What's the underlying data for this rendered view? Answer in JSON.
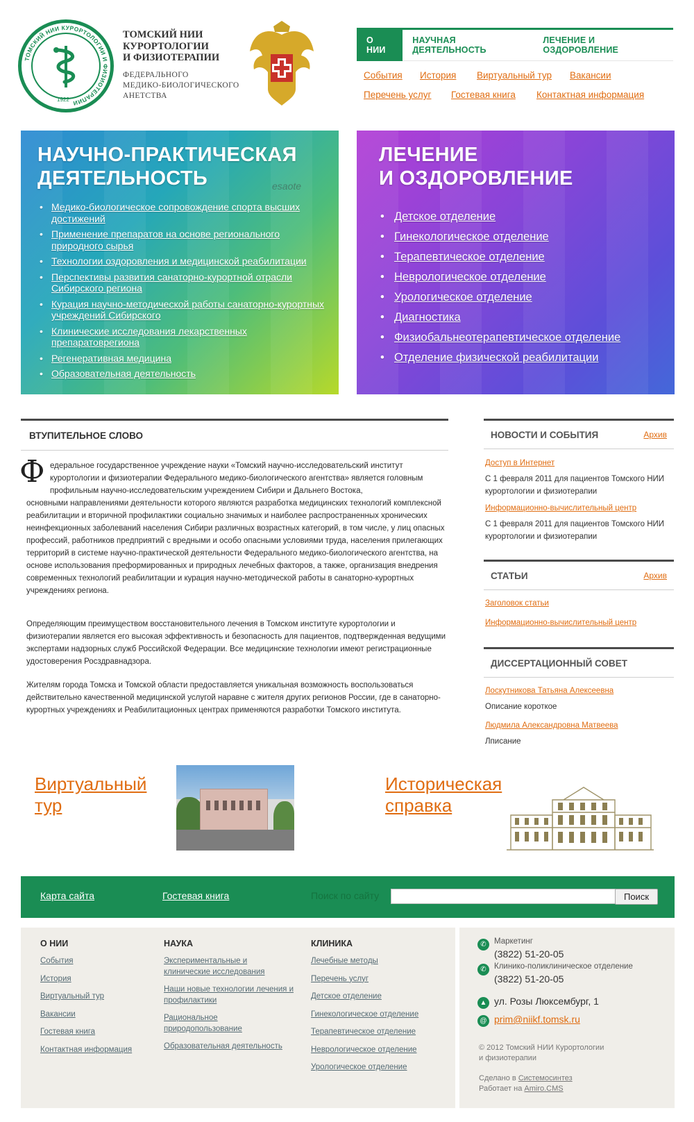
{
  "header": {
    "org_name_line1": "ТОМСКИЙ НИИ",
    "org_name_line2": "КУРОРТОЛОГИИ",
    "org_name_line3": "И ФИЗИОТЕРАПИИ",
    "org_sub_line1": "ФЕДЕРАЛЬНОГО",
    "org_sub_line2": "МЕДИКО-БИОЛОГИЧЕСКОГО",
    "org_sub_line3": "АНЕТСТВА",
    "seal_ring_text": "ТОМСКИЙ НИИ КУРОРТОЛОГИИ И ФИЗИОТЕРАПИИ",
    "seal_year": "1922"
  },
  "nav": {
    "tabs": [
      {
        "label": "О НИИ",
        "active": true
      },
      {
        "label": "НАУЧНАЯ ДЕЯТЕЛЬНОСТЬ",
        "active": false
      },
      {
        "label": "ЛЕЧЕНИЕ И ОЗДОРОВЛЕНИЕ",
        "active": false
      }
    ],
    "sublinks_row1": [
      "События",
      "История",
      "Виртуальный тур",
      "Вакансии"
    ],
    "sublinks_row2": [
      "Перечень услуг",
      "Гостевая книга",
      "Контактная информация"
    ]
  },
  "hero_science": {
    "title_line1": "НАУЧНО-ПРАКТИЧЕСКАЯ",
    "title_line2": "ДЕЯТЕЛЬНОСТЬ",
    "photo_text": "esaote",
    "items": [
      "Медико-биологическое сопровождение спорта высших достижений",
      "Применение препаратов на основе регионального природного сырья",
      "Технологии оздоровления и медицинской реабилитации",
      "Перспективы развития  санаторно-курортной отрасли Сибирского региона",
      "Курация научно-методической работы санаторно-курортных учреждений Сибирского",
      "Клинические исследования лекарственных препаратоврегиона",
      "Регенеративная медицина",
      "Образовательная деятельность"
    ]
  },
  "hero_treatment": {
    "title_line1": "ЛЕЧЕНИЕ",
    "title_line2": "И ОЗДОРОВЛЕНИЕ",
    "items": [
      "Детское отделение",
      "Гинекологическое отделение",
      "Терапевтическое отделение",
      "Неврологическое отделение",
      "Урологическое отделение",
      "Диагностика",
      "Физиобальнеотерапевтическое отделение",
      "Отделение физической реабилитации"
    ]
  },
  "intro": {
    "heading": "ВТУПИТЕЛЬНОЕ СЛОВО",
    "dropcap": "Ф",
    "p1_first": "едеральное государственное учреждение науки «Томский научно-исследовательский институт курортологии и физиотерапии Федерального медико-биологического агентства» является головным профильным научно-исследовательским учреждением Сибири и Дальнего Востока,",
    "p1_rest": "основными направлениями  деятельности которого являются  разработка медицинских технологий комплексной реабилитации и вторичной профилактики социально значимых и наиболее распространенных хронических неинфекционных  заболеваний населения Сибири различных возрастных категорий, в том числе,  у лиц опасных профессий, работников предприятий с вредными и особо опасными условиями труда, населения прилегающих территорий в системе научно-практической деятельности Федерального медико-биологического агентства, на основе использования преформированных и природных лечебных факторов, а также, организация внедрения современных технологий реабилитации и курация научно-методической работы в санаторно-курортных учреждениях региона.",
    "p2": "Определяющим преимуществом восстановительного лечения в Томском институте курортологии и физиотерапии является его высокая эффективность и безопасность для пациентов, подтвержденная ведущими экспертами надзорных служб Российской Федерации. Все медицинские технологии имеют регистрационные  удостоверения Росздравнадзора.",
    "p3": "Жителям города Томска и Томской области предоставляется уникальная возможность воспользоваться действительно качественной медицинской услугой наравне с жителя других регионов России, где в санаторно-курортных учреждениях и Реабилитационных центрах применяются разработки Томского института."
  },
  "news": {
    "heading": "НОВОСТИ И СОБЫТИЯ",
    "archive": "Архив",
    "items": [
      {
        "title": "Доступ в Интернет",
        "text": "С 1 февраля 2011 для пациентов Томского НИИ курортологии и физиотерапии"
      },
      {
        "title": "Информационно-вычислительный центр",
        "text": "С 1 февраля 2011 для пациентов Томского НИИ курортологии и физиотерапии"
      }
    ]
  },
  "articles": {
    "heading": "СТАТЬИ",
    "archive": "Архив",
    "items": [
      "Заголовок статьи",
      "Информационно-вычислительный центр"
    ]
  },
  "council": {
    "heading": "ДИССЕРТАЦИОННЫЙ СОВЕТ",
    "items": [
      {
        "name": "Лоскутникова Татьяна Алексеевна",
        "text": "Описание короткое"
      },
      {
        "name": "Людмила Александровна Матвеева",
        "text": "Лписание"
      }
    ]
  },
  "promo": {
    "virtual_line1": "Виртуальный",
    "virtual_line2": "тур",
    "history_line1": "Историческая",
    "history_line2": "справка"
  },
  "greenbar": {
    "sitemap": "Карта сайта",
    "guestbook": "Гостевая книга",
    "search_label": "Поиск по сайту",
    "search_value": "",
    "search_button": "Поиск"
  },
  "footer": {
    "col1": {
      "heading": "О НИИ",
      "links": [
        "События",
        "История",
        "Виртуальный тур",
        "Вакансии",
        "Гостевая книга",
        "Контактная информация"
      ]
    },
    "col2": {
      "heading": "НАУКА",
      "links": [
        "Экспериментальные и клинические исследования",
        "Наши новые технологии лечения и профилактики",
        "Рациональное природопользование",
        "Образовательная деятельность"
      ]
    },
    "col3": {
      "heading": "КЛИНИКА",
      "links": [
        "Лечебные методы",
        "Перечень услуг",
        "Детское отделение",
        "Гинекологическое отделение",
        "Терапевтическое отделение",
        "Неврологическое отделение",
        "Урологическое отделение"
      ]
    },
    "contacts": {
      "label1": "Маркетинг",
      "phone1": "(3822) 51-20-05",
      "label2": "Клинико-поликлиническое отделение",
      "phone2": "(3822) 51-20-05",
      "address": "ул. Розы Люксембург, 1",
      "email": "prim@niikf.tomsk.ru"
    },
    "copyright_line1": "© 2012  Томский НИИ Курортологии",
    "copyright_line2": "и физиотерапии",
    "made_prefix": "Сделано в",
    "made_link": "Системосинтез",
    "cms_prefix": "Работает на",
    "cms_link": "Amiro.CMS"
  },
  "colors": {
    "brand_green": "#1a8d54",
    "link_orange": "#e06d12",
    "footer_bg": "#f0eee9"
  },
  "icons": [
    "caduceus-icon",
    "coat-of-arms-icon",
    "phone-icon",
    "location-icon",
    "email-icon"
  ]
}
